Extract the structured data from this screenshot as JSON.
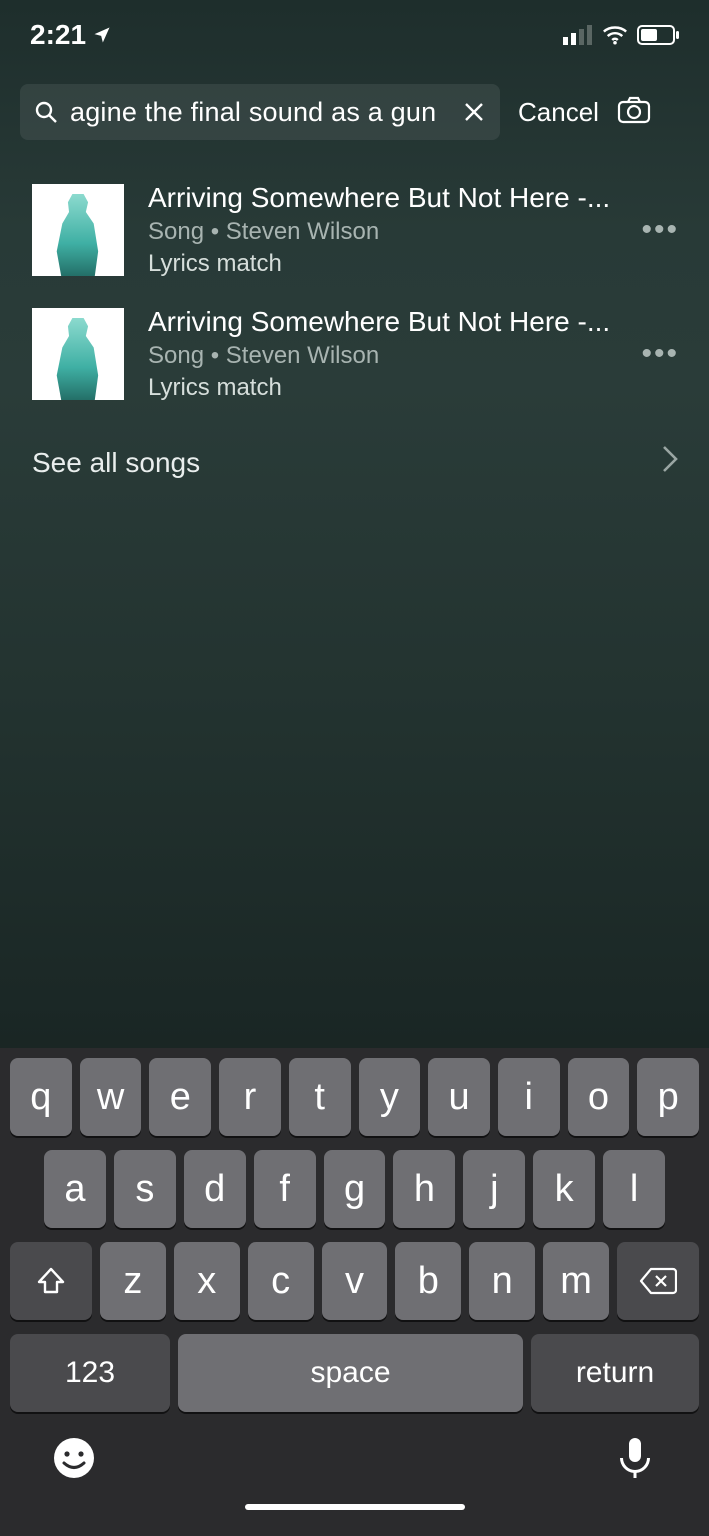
{
  "status": {
    "time": "2:21",
    "location_icon": "location-arrow"
  },
  "search": {
    "query": "agine the final sound as a gun",
    "cancel_label": "Cancel"
  },
  "results": [
    {
      "title": "Arriving Somewhere But Not Here -...",
      "subtitle": "Song • Steven Wilson",
      "extra": "Lyrics match"
    },
    {
      "title": "Arriving Somewhere But Not Here -...",
      "subtitle": "Song • Steven Wilson",
      "extra": "Lyrics match"
    }
  ],
  "see_all": {
    "label": "See all songs"
  },
  "keyboard": {
    "row1": [
      "q",
      "w",
      "e",
      "r",
      "t",
      "y",
      "u",
      "i",
      "o",
      "p"
    ],
    "row2": [
      "a",
      "s",
      "d",
      "f",
      "g",
      "h",
      "j",
      "k",
      "l"
    ],
    "row3": [
      "z",
      "x",
      "c",
      "v",
      "b",
      "n",
      "m"
    ],
    "num_label": "123",
    "space_label": "space",
    "return_label": "return"
  }
}
